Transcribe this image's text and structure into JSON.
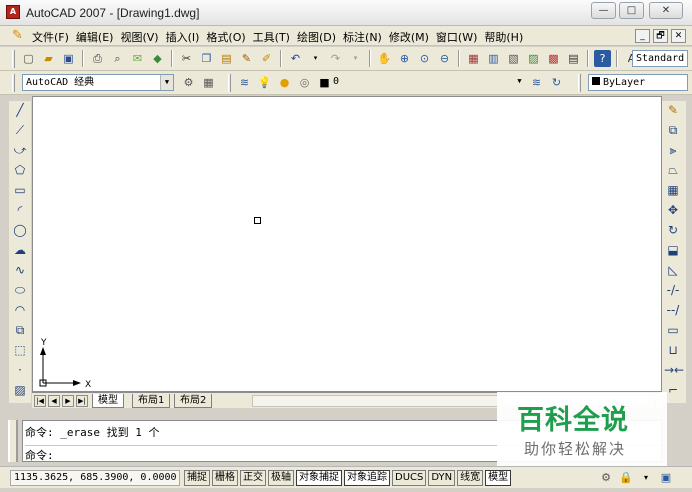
{
  "window": {
    "title": "AutoCAD 2007 - [Drawing1.dwg]",
    "min_glyph": "—",
    "max_glyph": "□",
    "close_glyph": "✕",
    "app_icon_glyph": "A"
  },
  "menu": {
    "items": [
      "文件(F)",
      "编辑(E)",
      "视图(V)",
      "插入(I)",
      "格式(O)",
      "工具(T)",
      "绘图(D)",
      "标注(N)",
      "修改(M)",
      "窗口(W)",
      "帮助(H)"
    ],
    "mdi": [
      "_",
      "🗗",
      "✕"
    ]
  },
  "toolbars": {
    "workspace": "AutoCAD 经典",
    "layer": "0",
    "text_style": "Standard",
    "color": "ByLayer"
  },
  "tabs": {
    "model": "模型",
    "layout1": "布局1",
    "layout2": "布局2"
  },
  "ucs": {
    "x_label": "X",
    "y_label": "Y"
  },
  "command": {
    "history": "命令: _erase 找到 1 个",
    "prompt": "命令:"
  },
  "status": {
    "coordinates": "1135.3625, 685.3900, 0.0000",
    "toggles": [
      {
        "label": "捕捉",
        "on": false
      },
      {
        "label": "栅格",
        "on": false
      },
      {
        "label": "正交",
        "on": false
      },
      {
        "label": "极轴",
        "on": false
      },
      {
        "label": "对象捕捉",
        "on": true
      },
      {
        "label": "对象追踪",
        "on": true
      },
      {
        "label": "DUCS",
        "on": false
      },
      {
        "label": "DYN",
        "on": false
      },
      {
        "label": "线宽",
        "on": false
      },
      {
        "label": "模型",
        "on": true
      }
    ]
  },
  "watermark": {
    "title": "百科全说",
    "subtitle": "助你轻松解决"
  },
  "colors": {
    "watermark_green": "#1f9e4e",
    "canvas_bg": "#ffffff",
    "chrome_bg": "#ece9d8"
  }
}
